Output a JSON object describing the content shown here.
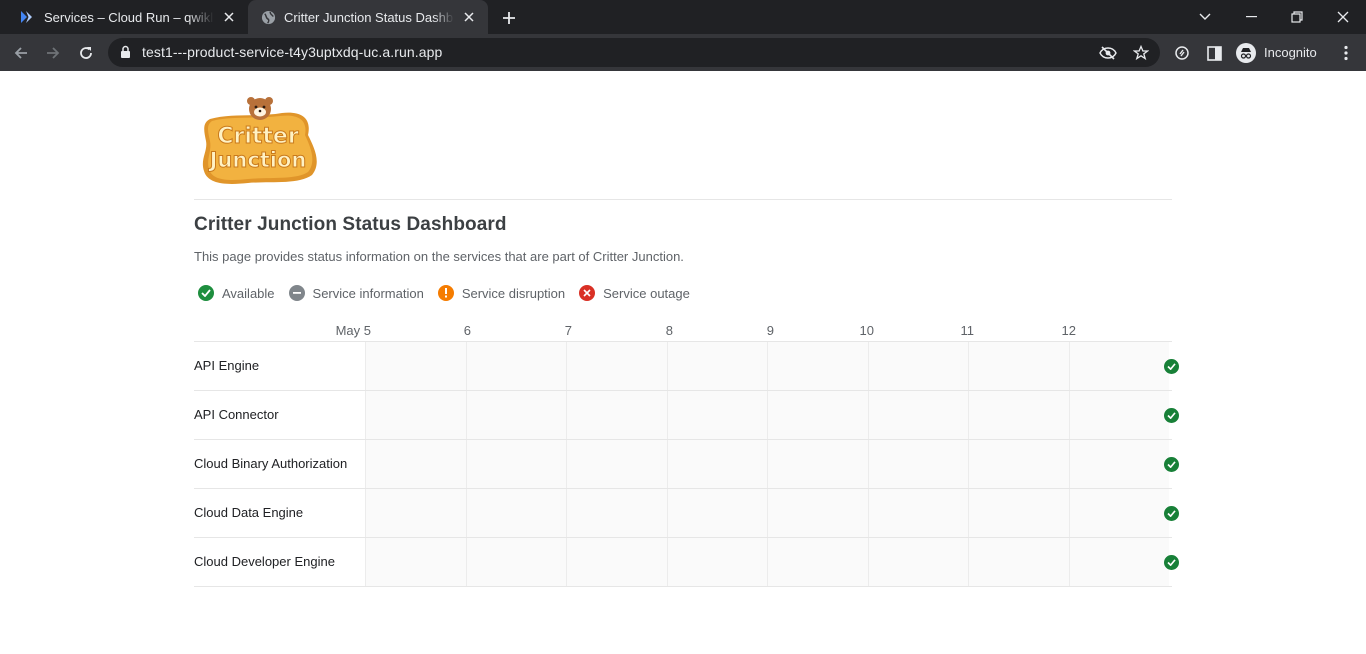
{
  "browser": {
    "tabs": [
      {
        "title": "Services – Cloud Run – qwiklabs-",
        "active": false,
        "icon": "cloud-run-icon"
      },
      {
        "title": "Critter Junction Status Dashboard",
        "active": true,
        "icon": "globe-icon"
      }
    ],
    "url": "test1---product-service-t4y3uptxdq-uc.a.run.app",
    "incognito_label": "Incognito"
  },
  "page": {
    "logo_text": "Critter Junction",
    "title": "Critter Junction Status Dashboard",
    "description": "This page provides status information on the services that are part of Critter Junction.",
    "legend": [
      {
        "label": "Available",
        "color": "#1e8e3e",
        "icon": "check-circle-icon"
      },
      {
        "label": "Service information",
        "color": "#80868b",
        "icon": "info-circle-icon"
      },
      {
        "label": "Service disruption",
        "color": "#f57c00",
        "icon": "exclamation-circle-icon"
      },
      {
        "label": "Service outage",
        "color": "#d93025",
        "icon": "x-circle-icon"
      }
    ],
    "dates": [
      "May 5",
      "6",
      "7",
      "8",
      "9",
      "10",
      "11",
      "12"
    ],
    "services": [
      {
        "name": "API Engine",
        "status": "Available"
      },
      {
        "name": "API Connector",
        "status": "Available"
      },
      {
        "name": "Cloud Binary Authorization",
        "status": "Available"
      },
      {
        "name": "Cloud Data Engine",
        "status": "Available"
      },
      {
        "name": "Cloud Developer Engine",
        "status": "Available"
      }
    ]
  }
}
